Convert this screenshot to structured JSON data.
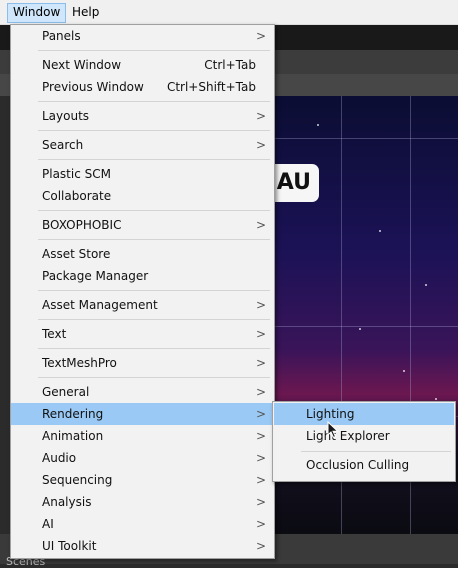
{
  "menubar": {
    "items": [
      {
        "label": "Window"
      },
      {
        "label": "Help"
      }
    ]
  },
  "scene": {
    "bottom_label": "Scenes",
    "pill_text": "AU"
  },
  "window_menu": {
    "items": [
      {
        "label": "Panels",
        "submenu": true
      },
      {
        "label": "Next Window",
        "shortcut": "Ctrl+Tab"
      },
      {
        "label": "Previous Window",
        "shortcut": "Ctrl+Shift+Tab"
      },
      {
        "label": "Layouts",
        "submenu": true
      },
      {
        "label": "Search",
        "submenu": true
      },
      {
        "label": "Plastic SCM"
      },
      {
        "label": "Collaborate"
      },
      {
        "label": "BOXOPHOBIC",
        "submenu": true
      },
      {
        "label": "Asset Store"
      },
      {
        "label": "Package Manager"
      },
      {
        "label": "Asset Management",
        "submenu": true
      },
      {
        "label": "Text",
        "submenu": true
      },
      {
        "label": "TextMeshPro",
        "submenu": true
      },
      {
        "label": "General",
        "submenu": true
      },
      {
        "label": "Rendering",
        "submenu": true,
        "highlighted": true
      },
      {
        "label": "Animation",
        "submenu": true
      },
      {
        "label": "Audio",
        "submenu": true
      },
      {
        "label": "Sequencing",
        "submenu": true
      },
      {
        "label": "Analysis",
        "submenu": true
      },
      {
        "label": "AI",
        "submenu": true
      },
      {
        "label": "UI Toolkit",
        "submenu": true
      }
    ]
  },
  "rendering_submenu": {
    "items": [
      {
        "label": "Lighting",
        "highlighted": true
      },
      {
        "label": "Light Explorer"
      },
      {
        "label": "Occlusion Culling"
      }
    ]
  },
  "colors": {
    "highlight": "#99c9f4",
    "menu_bg": "#f2f2f2"
  }
}
